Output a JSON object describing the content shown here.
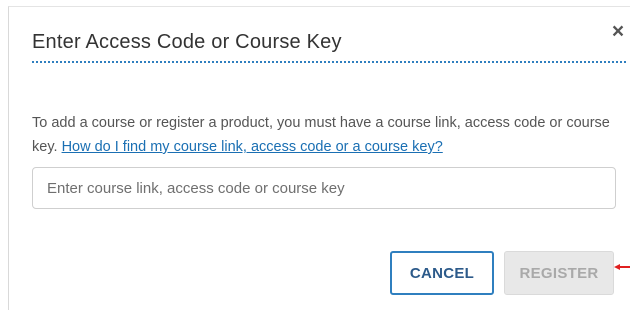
{
  "dialog": {
    "title": "Enter Access Code or Course Key",
    "close_glyph": "×",
    "description": "To add a course or register a product, you must have a course link, access code or course key.",
    "help_link": "How do I find my course link, access code or a course key?",
    "input": {
      "value": "",
      "placeholder": "Enter course link, access code or course key"
    },
    "buttons": {
      "cancel": "CANCEL",
      "register": "REGISTER"
    }
  },
  "colors": {
    "accent": "#2f7fbf",
    "link": "#1a6fb3",
    "disabled_bg": "#e8e8e8",
    "disabled_text": "#a9a9a9",
    "annotation_arrow": "#e02020"
  },
  "icons": {
    "close": "close-icon",
    "annotation": "red-arrow-icon"
  }
}
